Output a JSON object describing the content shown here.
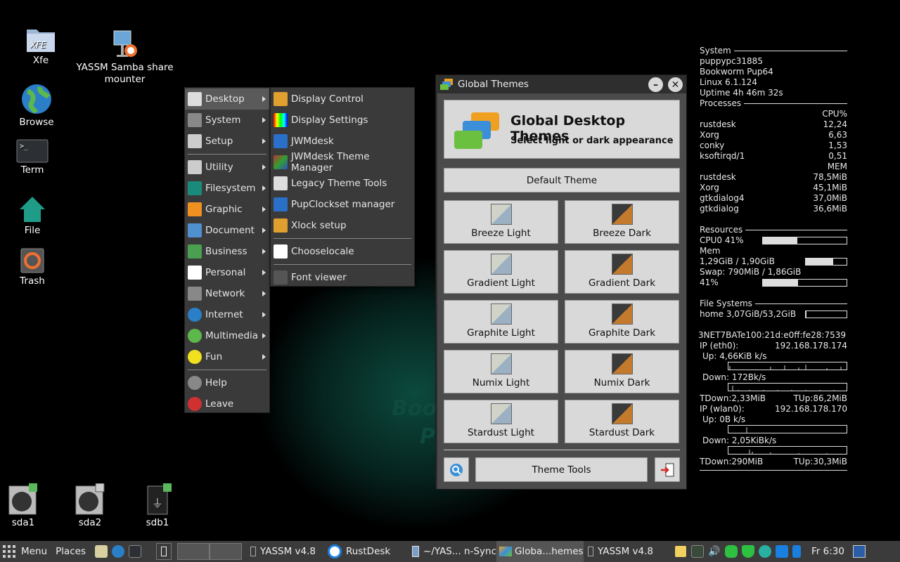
{
  "desktop": {
    "icons": [
      {
        "label": "Xfe",
        "icon": "xfe-folder-icon"
      },
      {
        "label": "YASSM Samba share mounter",
        "icon": "yassm-icon"
      },
      {
        "label": "Browse",
        "icon": "globe-icon"
      },
      {
        "label": "Term",
        "icon": "terminal-icon"
      },
      {
        "label": "File",
        "icon": "home-icon"
      },
      {
        "label": "Trash",
        "icon": "trash-icon"
      }
    ],
    "drives": [
      {
        "label": "sda1",
        "icon": "hard-drive-icon"
      },
      {
        "label": "sda2",
        "icon": "hard-drive-icon"
      },
      {
        "label": "sdb1",
        "icon": "usb-drive-icon"
      }
    ],
    "wallpaper_text": [
      "Boo",
      "P"
    ]
  },
  "main_menu": {
    "items": [
      {
        "label": "Desktop",
        "icon": "desktop-icon",
        "selected": true
      },
      {
        "label": "System",
        "icon": "system-icon"
      },
      {
        "label": "Setup",
        "icon": "setup-icon"
      },
      {
        "label": "Utility",
        "icon": "utility-icon"
      },
      {
        "label": "Filesystem",
        "icon": "folder-icon"
      },
      {
        "label": "Graphic",
        "icon": "graphic-icon"
      },
      {
        "label": "Document",
        "icon": "document-icon"
      },
      {
        "label": "Business",
        "icon": "spreadsheet-icon"
      },
      {
        "label": "Personal",
        "icon": "calendar-icon"
      },
      {
        "label": "Network",
        "icon": "network-icon"
      },
      {
        "label": "Internet",
        "icon": "internet-icon"
      },
      {
        "label": "Multimedia",
        "icon": "multimedia-icon"
      },
      {
        "label": "Fun",
        "icon": "pacman-icon"
      },
      {
        "label": "Help",
        "icon": "info-icon"
      },
      {
        "label": "Leave",
        "icon": "power-icon"
      }
    ]
  },
  "sub_menu": {
    "items": [
      {
        "label": "Display Control",
        "icon": "display-control-icon"
      },
      {
        "label": "Display Settings",
        "icon": "display-settings-icon"
      },
      {
        "label": "JWMdesk",
        "icon": "jwmdesk-icon"
      },
      {
        "label": "JWMdesk Theme Manager",
        "icon": "theme-manager-icon"
      },
      {
        "label": "Legacy Theme Tools",
        "icon": "legacy-theme-icon"
      },
      {
        "label": "PupClockset manager",
        "icon": "clock-icon"
      },
      {
        "label": "Xlock setup",
        "icon": "lock-icon"
      },
      {
        "label": "Chooselocale",
        "icon": "flag-icon"
      },
      {
        "label": "Font viewer",
        "icon": "font-icon"
      }
    ]
  },
  "dialog": {
    "title": "Global Themes",
    "header_title": "Global Desktop Themes",
    "header_subtitle": "Select light or dark appearance",
    "default_label": "Default Theme",
    "themes": [
      {
        "label": "Breeze Light",
        "style": "light"
      },
      {
        "label": "Breeze Dark",
        "style": "dark"
      },
      {
        "label": "Gradient Light",
        "style": "light"
      },
      {
        "label": "Gradient Dark",
        "style": "dark"
      },
      {
        "label": "Graphite Light",
        "style": "light"
      },
      {
        "label": "Graphite Dark",
        "style": "dark"
      },
      {
        "label": "Numix Light",
        "style": "light"
      },
      {
        "label": "Numix Dark",
        "style": "dark"
      },
      {
        "label": "Stardust Light",
        "style": "light"
      },
      {
        "label": "Stardust Dark",
        "style": "dark"
      }
    ],
    "tools_label": "Theme Tools"
  },
  "conky": {
    "system_head": "System",
    "hostname": "puppypc31885",
    "distro": "Bookworm Pup64",
    "kernel": "Linux 6.1.124",
    "uptime": "Uptime 4h 46m 32s",
    "processes_head": "Processes",
    "cpu_head": "CPU%",
    "cpu_procs": [
      [
        "rustdesk",
        "12,24"
      ],
      [
        "Xorg",
        "6,63"
      ],
      [
        "conky",
        "1,53"
      ],
      [
        "ksoftirqd/1",
        "0,51"
      ]
    ],
    "mem_head": "MEM",
    "mem_procs": [
      [
        "rustdesk",
        "78,5MiB"
      ],
      [
        "Xorg",
        "45,1MiB"
      ],
      [
        "gtkdialog4",
        "37,0MiB"
      ],
      [
        "gtkdialog",
        "36,6MiB"
      ]
    ],
    "resources_head": "Resources",
    "cpu0": "CPU0 41%",
    "cpu0_fraction": 0.41,
    "mem_label": "Mem",
    "mem_usage": "1,29GiB / 1,90GiB",
    "mem_fraction": 0.68,
    "swap": "Swap: 790MiB / 1,86GiB",
    "swap_pct": "41%",
    "swap_fraction": 0.42,
    "fs_head": "File Systems",
    "home": "home 3,07GiB/53,2GiB",
    "home_fraction": 0.02,
    "net_overlap": "3NET7BATe100:21d:e0ff:fe28:7539",
    "eth_label": "IP (eth0):",
    "eth_ip": "192.168.178.174",
    "eth_up": "Up: 4,66KiB k/s",
    "eth_down": "Down: 172Bk/s",
    "eth_tdown": "TDown:2,33MiB",
    "eth_tup": "TUp:86,2MiB",
    "wlan_label": "IP (wlan0):",
    "wlan_ip": "192.168.178.170",
    "wlan_up": "Up: 0B k/s",
    "wlan_down": "Down: 2,05KiBk/s",
    "wlan_tdown": "TDown:290MiB",
    "wlan_tup": "TUp:30,3MiB"
  },
  "taskbar": {
    "menu_label": "Menu",
    "places_label": "Places",
    "tasks": [
      "YASSM v4.8",
      "RustDesk",
      "~/YAS... n-Sync",
      "Globa...hemes",
      "YASSM v4.8"
    ],
    "clock": "Fr  6:30"
  }
}
